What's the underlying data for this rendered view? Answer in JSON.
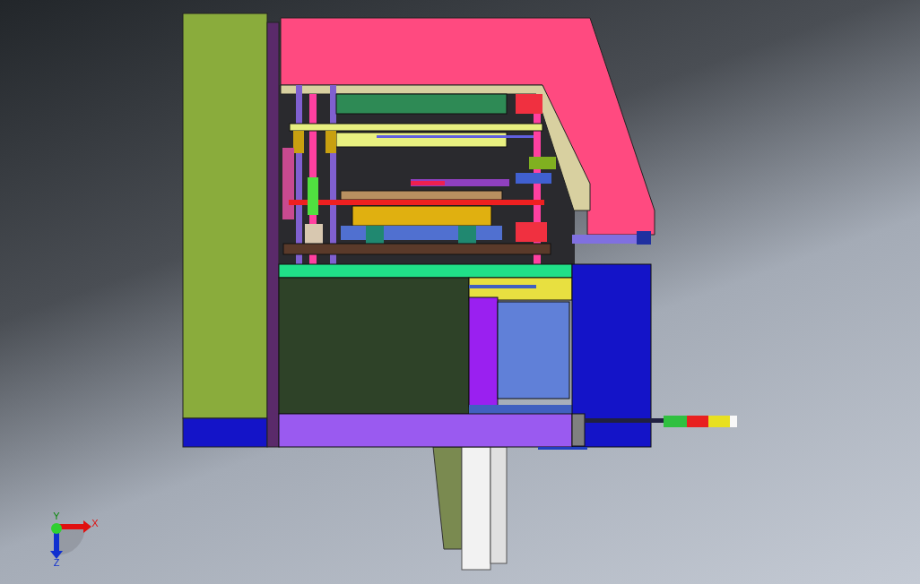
{
  "viewport": {
    "axis_triad": {
      "axes": [
        {
          "kind": "x",
          "label": "X"
        },
        {
          "kind": "y",
          "label": "Y"
        },
        {
          "kind": "z",
          "label": "Z"
        }
      ]
    }
  }
}
